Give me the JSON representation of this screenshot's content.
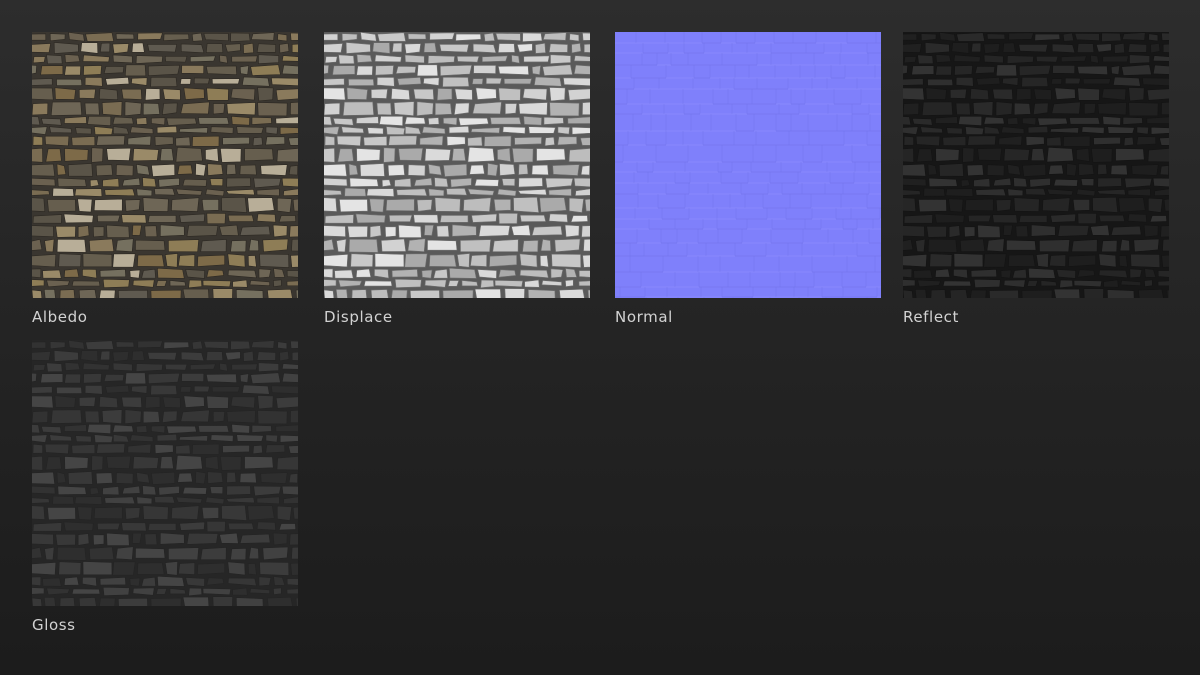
{
  "maps": [
    {
      "label": "Albedo"
    },
    {
      "label": "Displace"
    },
    {
      "label": "Normal"
    },
    {
      "label": "Reflect"
    },
    {
      "label": "Gloss"
    }
  ]
}
